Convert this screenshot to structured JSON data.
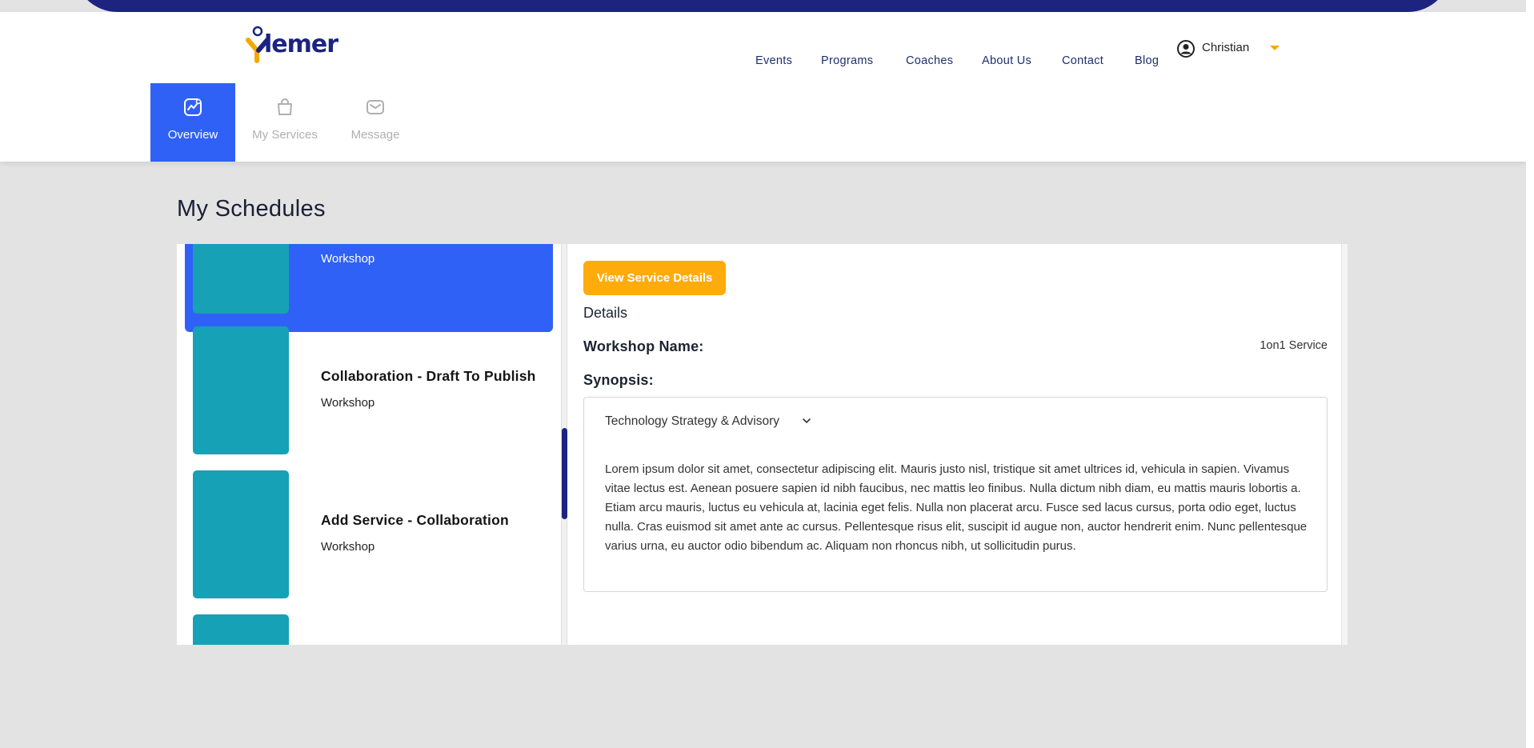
{
  "brand": {
    "name": "lemer",
    "accent": "#f5a800",
    "primary": "#1c2480"
  },
  "nav": {
    "items": [
      "Events",
      "Programs",
      "Coaches",
      "About Us",
      "Contact",
      "Blog"
    ],
    "user_name": "Christian",
    "user_icon": "user-circle-icon"
  },
  "tabs": [
    {
      "label": "Overview",
      "icon": "chart-icon",
      "active": true
    },
    {
      "label": "My Services",
      "icon": "bag-icon",
      "active": false
    },
    {
      "label": "Message",
      "icon": "envelope-icon",
      "active": false
    }
  ],
  "page": {
    "title": "My Schedules"
  },
  "schedule_list": [
    {
      "title": "",
      "type": "Workshop",
      "selected": true
    },
    {
      "title": "Collaboration - Draft To Publish",
      "type": "Workshop",
      "selected": false
    },
    {
      "title": "Add Service - Collaboration",
      "type": "Workshop",
      "selected": false
    }
  ],
  "details": {
    "button_label": "View Service Details",
    "heading": "Details",
    "workshop_name_label": "Workshop Name:",
    "workshop_name_value": "1on1 Service",
    "synopsis_label": "Synopsis:",
    "category": "Technology Strategy & Advisory",
    "synopsis": "Lorem ipsum dolor sit amet, consectetur adipiscing elit. Mauris justo nisl, tristique sit amet ultrices id, vehicula in sapien. Vivamus vitae lectus est. Aenean posuere sapien id nibh faucibus, nec mattis leo finibus. Nulla dictum nibh diam, eu mattis mauris lobortis a. Etiam arcu mauris, luctus eu vehicula at, lacinia eget felis. Nulla non placerat arcu. Fusce sed lacus cursus, porta odio eget, luctus nulla. Cras euismod sit amet ante ac cursus. Pellentesque risus elit, suscipit id augue non, auctor hendrerit enim. Nunc pellentesque varius urna, eu auctor odio bibendum ac. Aliquam non rhoncus nibh, ut sollicitudin purus."
  }
}
